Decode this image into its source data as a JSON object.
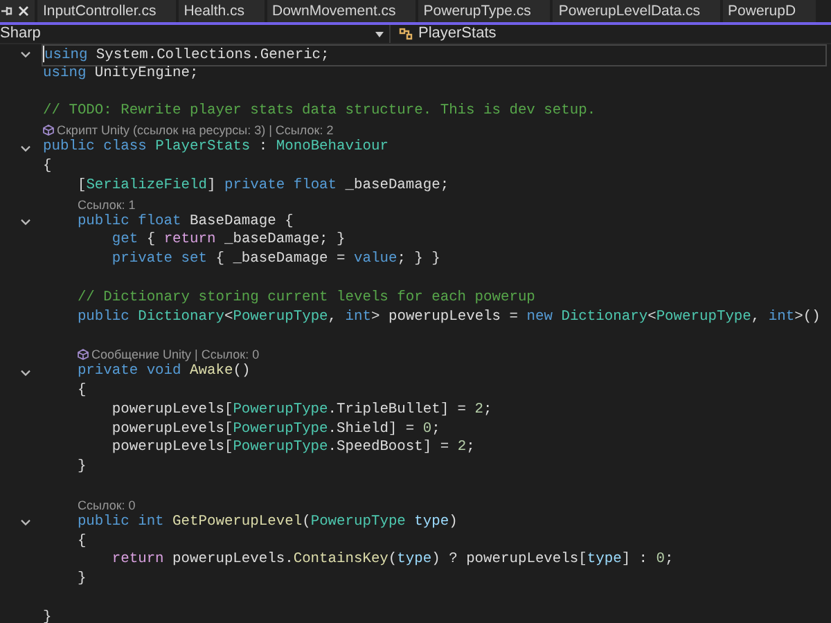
{
  "tabs": [
    {
      "label": "InputController.cs",
      "selected": false
    },
    {
      "label": "Health.cs",
      "selected": false
    },
    {
      "label": "DownMovement.cs",
      "selected": false
    },
    {
      "label": "PowerupType.cs",
      "selected": false
    },
    {
      "label": "PowerupLevelData.cs",
      "selected": false
    },
    {
      "label": "PowerupD",
      "selected": false
    }
  ],
  "navbar": {
    "project": "Sharp",
    "class_name": "PlayerStats"
  },
  "lines": [
    {
      "kind": "code",
      "fold": true,
      "current": true,
      "tokens": [
        {
          "kind": "kw",
          "text": "using"
        },
        {
          "kind": "pl",
          "text": " System.Collections.Generic;"
        }
      ]
    },
    {
      "kind": "code",
      "fold": false,
      "current": false,
      "tokens": [
        {
          "kind": "kw",
          "text": "using"
        },
        {
          "kind": "pl",
          "text": " UnityEngine;"
        }
      ]
    },
    {
      "kind": "blank"
    },
    {
      "kind": "code",
      "fold": false,
      "current": false,
      "tokens": [
        {
          "kind": "cm",
          "text": "// TODO: Rewrite player stats data structure. This is dev setup."
        }
      ]
    },
    {
      "kind": "lens",
      "unity_icon": true,
      "text": "Скрипт Unity (ссылок на ресурсы: 3) | Ссылок: 2"
    },
    {
      "kind": "code",
      "fold": true,
      "current": false,
      "tokens": [
        {
          "kind": "kw",
          "text": "public class"
        },
        {
          "kind": "ty",
          "text": " PlayerStats"
        },
        {
          "kind": "pl",
          "text": " : "
        },
        {
          "kind": "ty",
          "text": "MonoBehaviour"
        }
      ]
    },
    {
      "kind": "code",
      "fold": false,
      "current": false,
      "tokens": [
        {
          "kind": "pl",
          "text": "{"
        }
      ]
    },
    {
      "kind": "code",
      "fold": false,
      "current": false,
      "tokens": [
        {
          "kind": "pl",
          "text": "    ["
        },
        {
          "kind": "ty",
          "text": "SerializeField"
        },
        {
          "kind": "pl",
          "text": "] "
        },
        {
          "kind": "kw",
          "text": "private float"
        },
        {
          "kind": "pl",
          "text": " _baseDamage;"
        }
      ]
    },
    {
      "kind": "lens",
      "unity_icon": false,
      "text": "Ссылок: 1"
    },
    {
      "kind": "code",
      "fold": true,
      "current": false,
      "tokens": [
        {
          "kind": "kw",
          "text": "    public float"
        },
        {
          "kind": "pl",
          "text": " BaseDamage {"
        }
      ]
    },
    {
      "kind": "code",
      "fold": false,
      "current": false,
      "tokens": [
        {
          "kind": "kw",
          "text": "        get"
        },
        {
          "kind": "pl",
          "text": " { "
        },
        {
          "kind": "ct",
          "text": "return"
        },
        {
          "kind": "pl",
          "text": " _baseDamage; }"
        }
      ]
    },
    {
      "kind": "code",
      "fold": false,
      "current": false,
      "tokens": [
        {
          "kind": "kw",
          "text": "        private set"
        },
        {
          "kind": "pl",
          "text": " { _baseDamage = "
        },
        {
          "kind": "kw",
          "text": "value"
        },
        {
          "kind": "pl",
          "text": "; } }"
        }
      ]
    },
    {
      "kind": "blank"
    },
    {
      "kind": "code",
      "fold": false,
      "current": false,
      "tokens": [
        {
          "kind": "cm",
          "text": "    // Dictionary storing current levels for each powerup"
        }
      ]
    },
    {
      "kind": "code",
      "fold": false,
      "current": false,
      "tokens": [
        {
          "kind": "kw",
          "text": "    public"
        },
        {
          "kind": "ty",
          "text": " Dictionary"
        },
        {
          "kind": "pl",
          "text": "<"
        },
        {
          "kind": "ty",
          "text": "PowerupType"
        },
        {
          "kind": "pl",
          "text": ", "
        },
        {
          "kind": "kw",
          "text": "int"
        },
        {
          "kind": "pl",
          "text": "> powerupLevels = "
        },
        {
          "kind": "kw",
          "text": "new"
        },
        {
          "kind": "ty",
          "text": " Dictionary"
        },
        {
          "kind": "pl",
          "text": "<"
        },
        {
          "kind": "ty",
          "text": "PowerupType"
        },
        {
          "kind": "pl",
          "text": ", "
        },
        {
          "kind": "kw",
          "text": "int"
        },
        {
          "kind": "pl",
          "text": ">()"
        }
      ]
    },
    {
      "kind": "blank"
    },
    {
      "kind": "lens",
      "unity_icon": true,
      "text": "Сообщение Unity | Ссылок: 0"
    },
    {
      "kind": "code",
      "fold": true,
      "current": false,
      "tokens": [
        {
          "kind": "kw",
          "text": "    private void"
        },
        {
          "kind": "fn",
          "text": " Awake"
        },
        {
          "kind": "pl",
          "text": "()"
        }
      ]
    },
    {
      "kind": "code",
      "fold": false,
      "current": false,
      "tokens": [
        {
          "kind": "pl",
          "text": "    {"
        }
      ]
    },
    {
      "kind": "code",
      "fold": false,
      "current": false,
      "tokens": [
        {
          "kind": "pl",
          "text": "        powerupLevels["
        },
        {
          "kind": "ty",
          "text": "PowerupType"
        },
        {
          "kind": "pl",
          "text": ".TripleBullet] = "
        },
        {
          "kind": "nu",
          "text": "2"
        },
        {
          "kind": "pl",
          "text": ";"
        }
      ]
    },
    {
      "kind": "code",
      "fold": false,
      "current": false,
      "tokens": [
        {
          "kind": "pl",
          "text": "        powerupLevels["
        },
        {
          "kind": "ty",
          "text": "PowerupType"
        },
        {
          "kind": "pl",
          "text": ".Shield] = "
        },
        {
          "kind": "nu",
          "text": "0"
        },
        {
          "kind": "pl",
          "text": ";"
        }
      ]
    },
    {
      "kind": "code",
      "fold": false,
      "current": false,
      "tokens": [
        {
          "kind": "pl",
          "text": "        powerupLevels["
        },
        {
          "kind": "ty",
          "text": "PowerupType"
        },
        {
          "kind": "pl",
          "text": ".SpeedBoost] = "
        },
        {
          "kind": "nu",
          "text": "2"
        },
        {
          "kind": "pl",
          "text": ";"
        }
      ]
    },
    {
      "kind": "code",
      "fold": false,
      "current": false,
      "tokens": [
        {
          "kind": "pl",
          "text": "    }"
        }
      ]
    },
    {
      "kind": "blank"
    },
    {
      "kind": "lens",
      "unity_icon": false,
      "text": "Ссылок: 0"
    },
    {
      "kind": "code",
      "fold": true,
      "current": false,
      "tokens": [
        {
          "kind": "kw",
          "text": "    public int"
        },
        {
          "kind": "fn",
          "text": " GetPowerupLevel"
        },
        {
          "kind": "pl",
          "text": "("
        },
        {
          "kind": "ty",
          "text": "PowerupType"
        },
        {
          "kind": "pa",
          "text": " type"
        },
        {
          "kind": "pl",
          "text": ")"
        }
      ]
    },
    {
      "kind": "code",
      "fold": false,
      "current": false,
      "tokens": [
        {
          "kind": "pl",
          "text": "    {"
        }
      ]
    },
    {
      "kind": "code",
      "fold": false,
      "current": false,
      "tokens": [
        {
          "kind": "ct",
          "text": "        return"
        },
        {
          "kind": "pl",
          "text": " powerupLevels."
        },
        {
          "kind": "fn",
          "text": "ContainsKey"
        },
        {
          "kind": "pl",
          "text": "("
        },
        {
          "kind": "pa",
          "text": "type"
        },
        {
          "kind": "pl",
          "text": ") ? powerupLevels["
        },
        {
          "kind": "pa",
          "text": "type"
        },
        {
          "kind": "pl",
          "text": "] : "
        },
        {
          "kind": "nu",
          "text": "0"
        },
        {
          "kind": "pl",
          "text": ";"
        }
      ]
    },
    {
      "kind": "code",
      "fold": false,
      "current": false,
      "tokens": [
        {
          "kind": "pl",
          "text": "    }"
        }
      ]
    },
    {
      "kind": "blank"
    },
    {
      "kind": "code",
      "fold": false,
      "current": false,
      "tokens": [
        {
          "kind": "pl",
          "text": "}"
        }
      ]
    }
  ]
}
